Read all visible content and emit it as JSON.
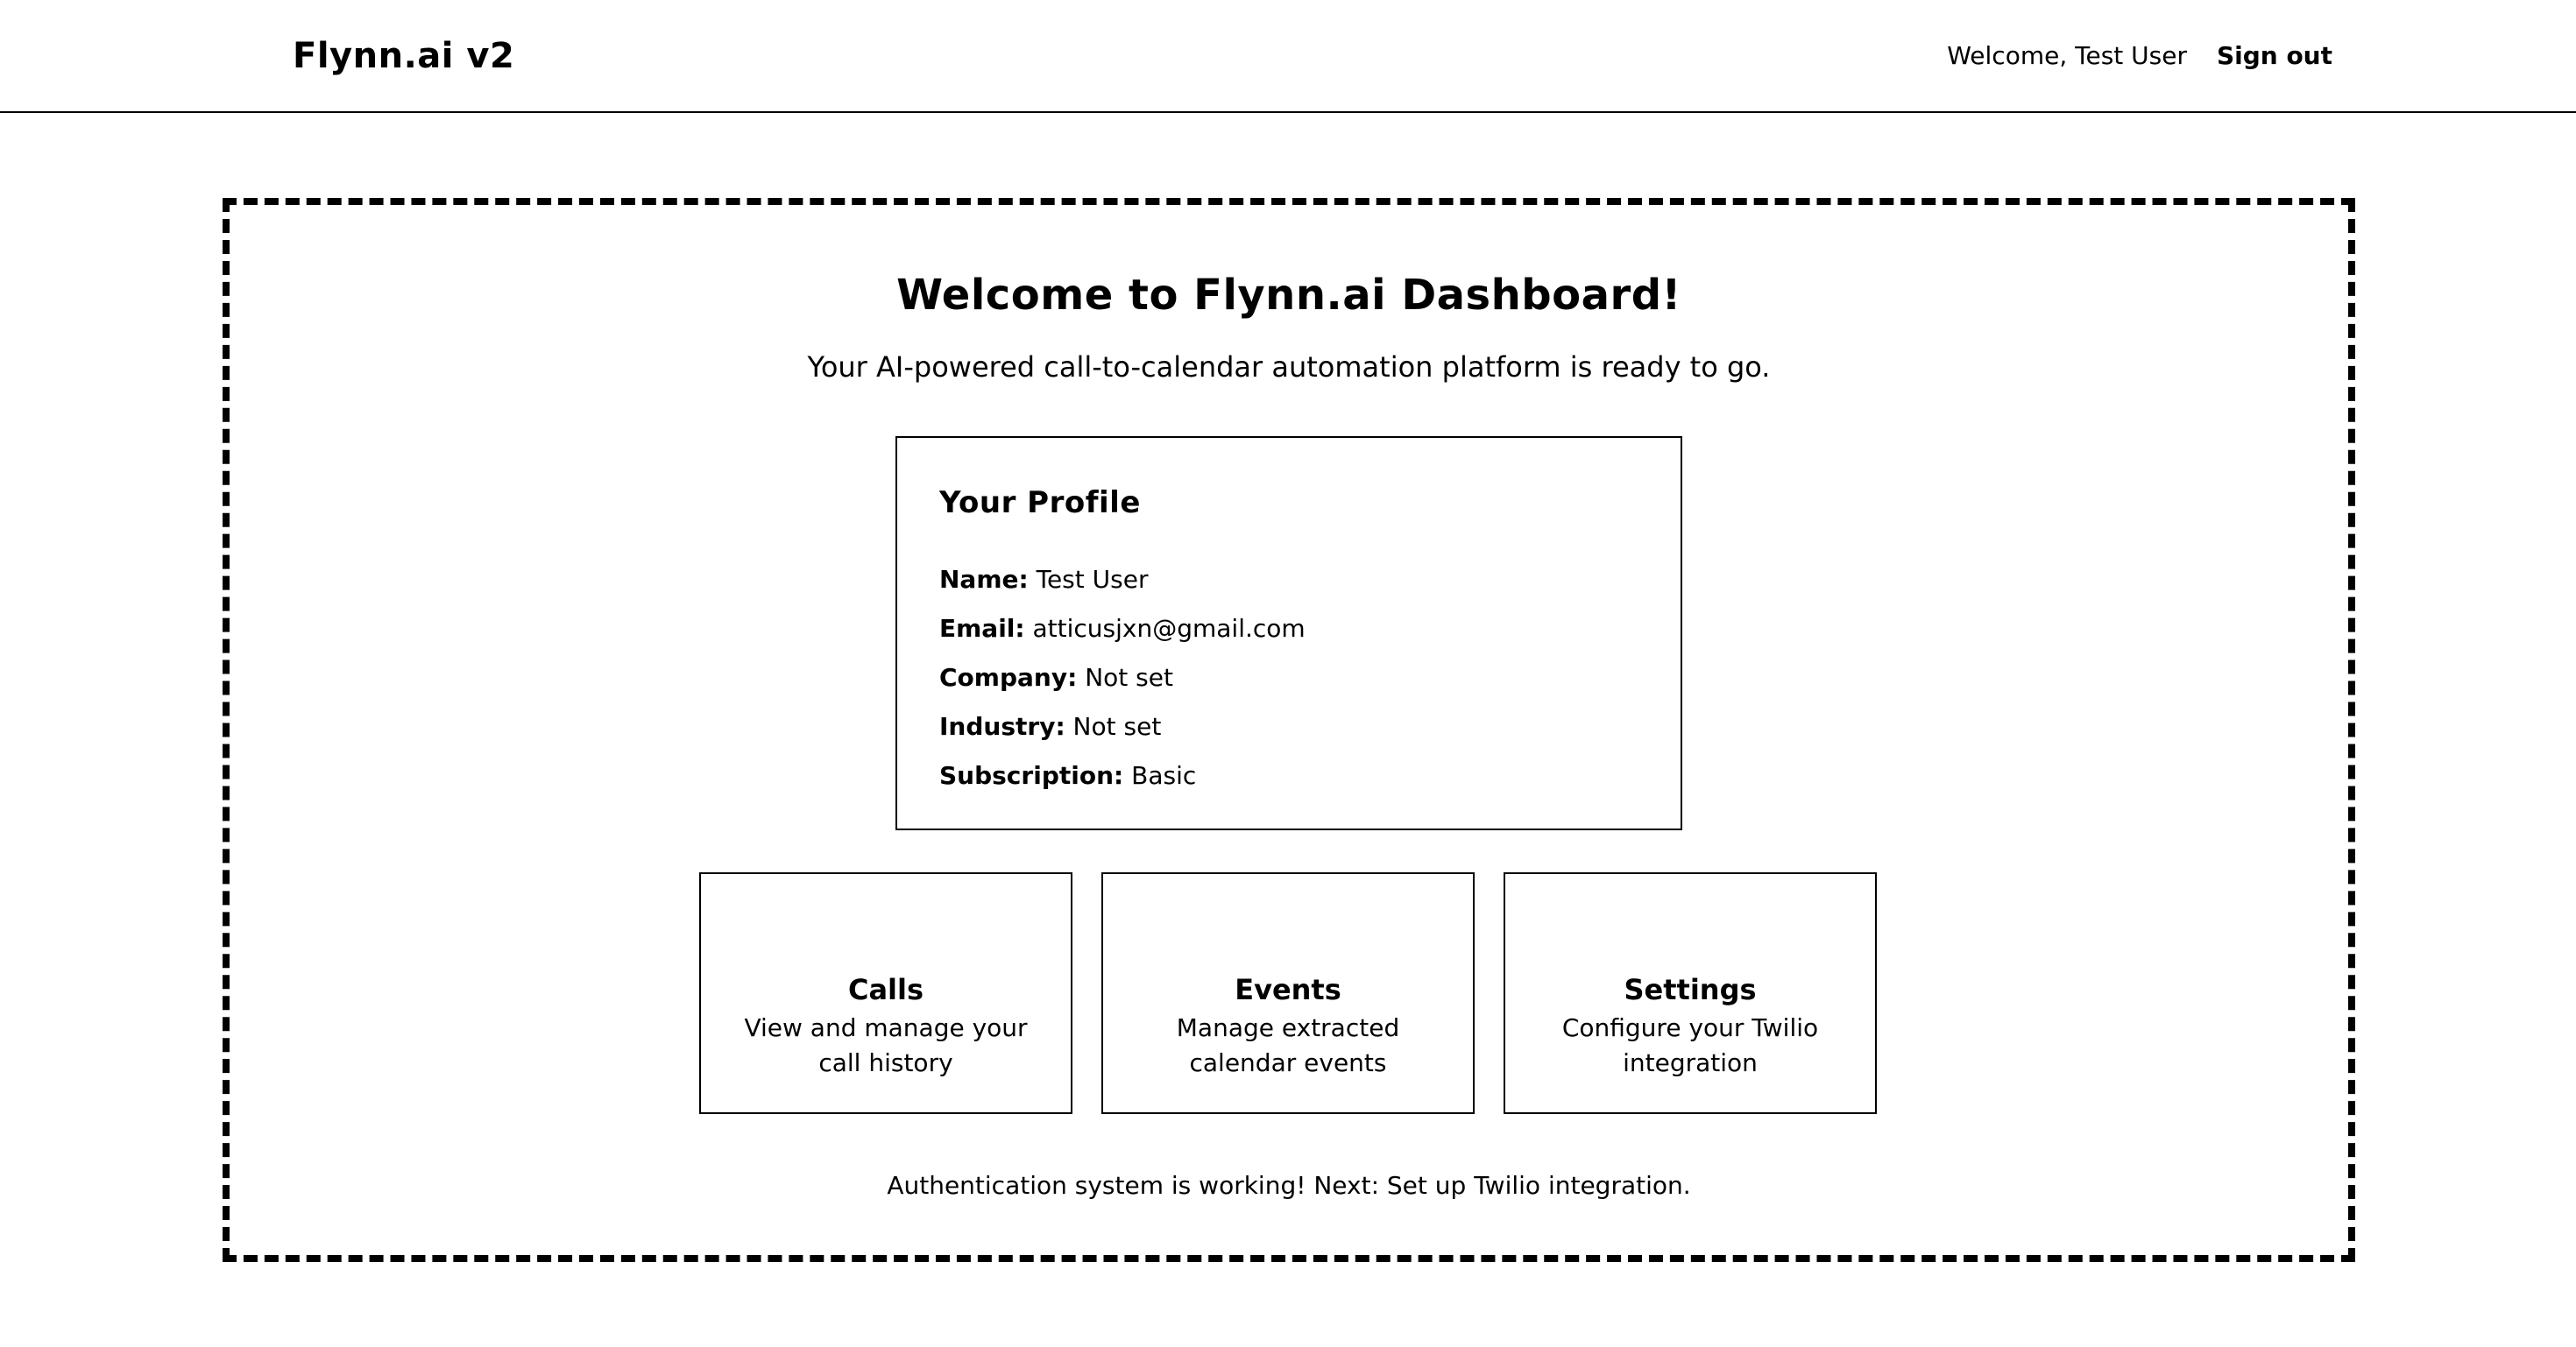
{
  "header": {
    "brand": "Flynn.ai v2",
    "welcome": "Welcome, Test User",
    "sign_out": "Sign out"
  },
  "dashboard": {
    "title": "Welcome to Flynn.ai Dashboard!",
    "subtitle": "Your AI-powered call-to-calendar automation platform is ready to go.",
    "profile": {
      "title": "Your Profile",
      "fields": [
        {
          "label": "Name:",
          "value": "Test User"
        },
        {
          "label": "Email:",
          "value": "atticusjxn@gmail.com"
        },
        {
          "label": "Company:",
          "value": "Not set"
        },
        {
          "label": "Industry:",
          "value": "Not set"
        },
        {
          "label": "Subscription:",
          "value": "Basic"
        }
      ]
    },
    "cards": [
      {
        "title": "Calls",
        "description": "View and manage your call history"
      },
      {
        "title": "Events",
        "description": "Manage extracted calendar events"
      },
      {
        "title": "Settings",
        "description": "Configure your Twilio integration"
      }
    ],
    "footer_note": "Authentication system is working! Next: Set up Twilio integration."
  }
}
